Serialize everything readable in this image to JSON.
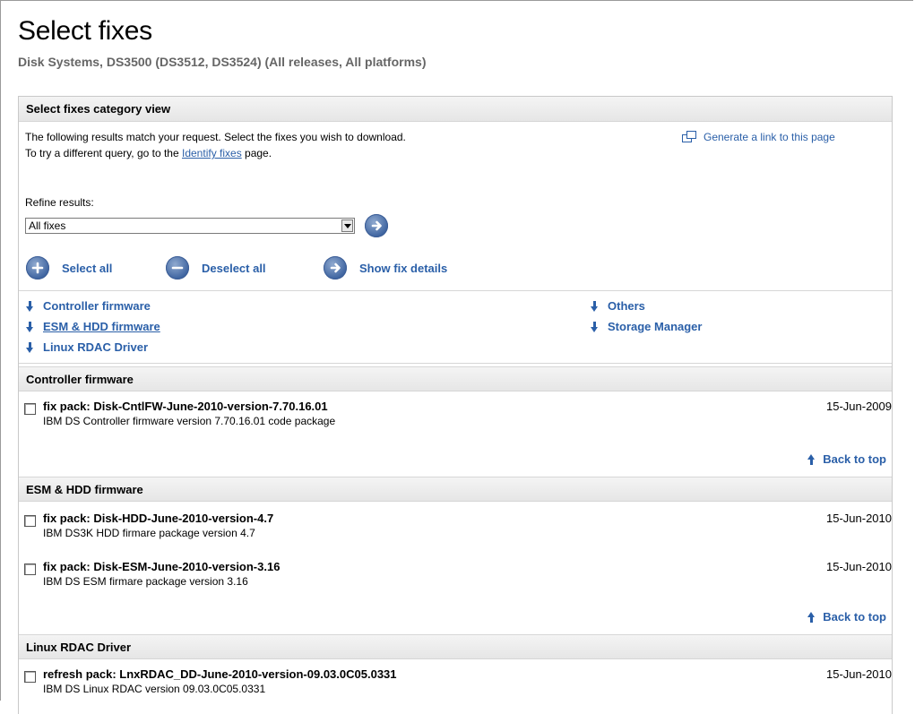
{
  "header": {
    "title": "Select fixes",
    "subtitle": "Disk Systems, DS3500 (DS3512, DS3524) (All releases, All platforms)"
  },
  "panel": {
    "heading": "Select fixes category view",
    "intro_line1": "The following results match your request. Select the fixes you wish to download.",
    "intro_line2_prefix": "To try a different query, go to the ",
    "intro_link": "Identify fixes",
    "intro_line2_suffix": " page.",
    "generate_link": "Generate a link to this page",
    "refine_label": "Refine results:",
    "refine_value": "All fixes",
    "actions": {
      "select_all": "Select all",
      "deselect_all": "Deselect all",
      "show_details": "Show fix details"
    },
    "toc": [
      "Controller firmware",
      "ESM & HDD firmware",
      "Linux RDAC Driver",
      "Others",
      "Storage Manager"
    ],
    "back_to_top": "Back to top"
  },
  "sections": [
    {
      "title": "Controller firmware",
      "fixes": [
        {
          "name": "fix pack: Disk-CntlFW-June-2010-version-7.70.16.01",
          "desc": "IBM DS Controller firmware version 7.70.16.01 code package",
          "date": "15-Jun-2009"
        }
      ]
    },
    {
      "title": "ESM & HDD firmware",
      "fixes": [
        {
          "name": "fix pack: Disk-HDD-June-2010-version-4.7",
          "desc": "IBM DS3K HDD firmare package version 4.7",
          "date": "15-Jun-2010"
        },
        {
          "name": "fix pack: Disk-ESM-June-2010-version-3.16",
          "desc": "IBM DS ESM firmare package version 3.16",
          "date": "15-Jun-2010"
        }
      ]
    },
    {
      "title": "Linux RDAC Driver",
      "fixes": [
        {
          "name": "refresh pack: LnxRDAC_DD-June-2010-version-09.03.0C05.0331",
          "desc": "IBM DS Linux RDAC version 09.03.0C05.0331",
          "date": "15-Jun-2010"
        }
      ]
    }
  ],
  "colors": {
    "link": "#2a5fa8",
    "button": "#3e64a0",
    "header_bg": "#e6e6e6"
  }
}
